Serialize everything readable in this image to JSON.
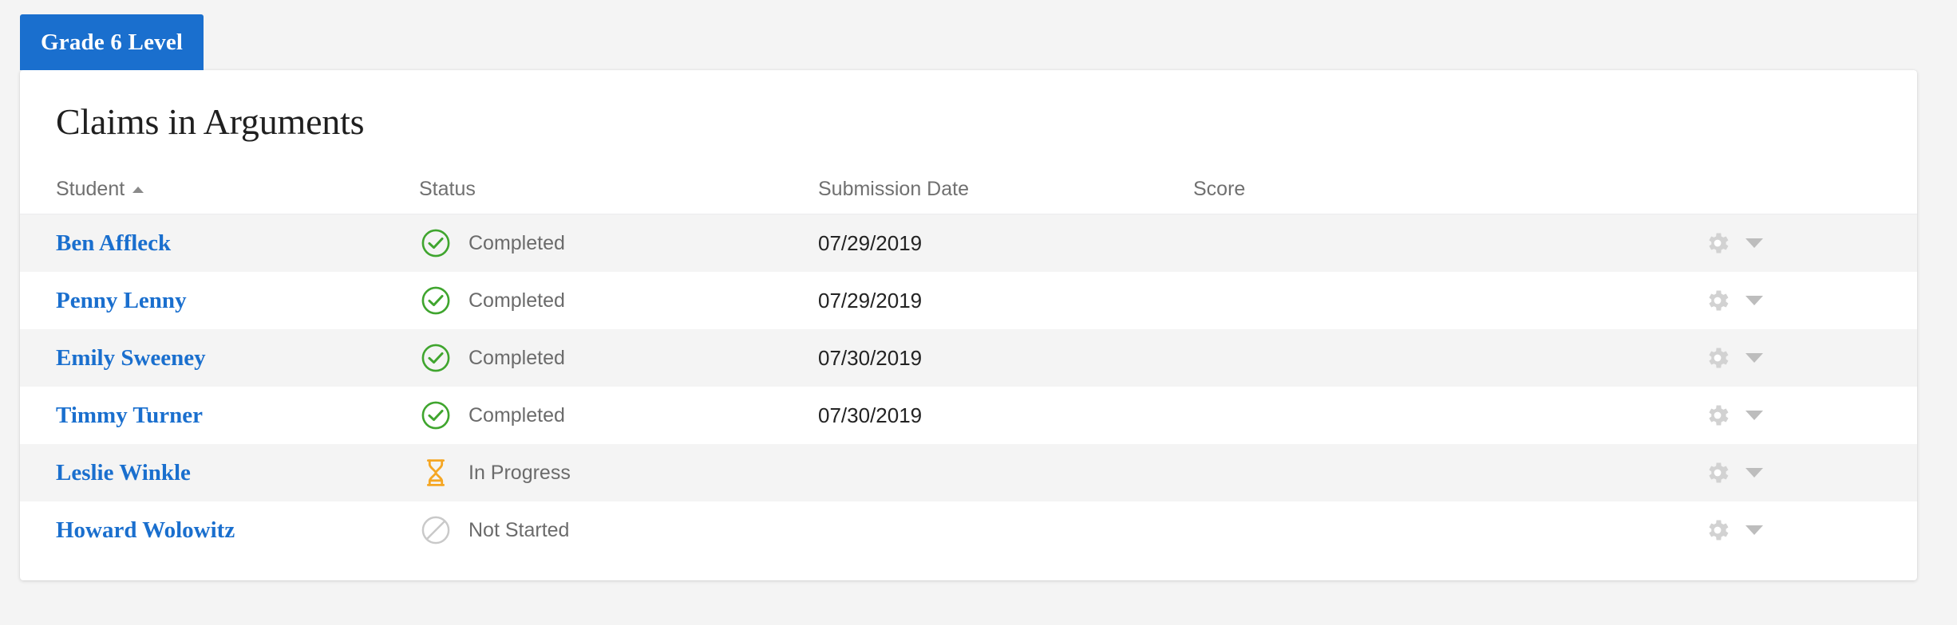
{
  "tabs": [
    {
      "label": "Grade 6 Level",
      "active": true
    }
  ],
  "card": {
    "title": "Claims in Arguments"
  },
  "table": {
    "columns": [
      {
        "key": "student",
        "label": "Student",
        "sorted": "asc",
        "sort_icon": "caret-up-icon"
      },
      {
        "key": "status",
        "label": "Status"
      },
      {
        "key": "date",
        "label": "Submission Date"
      },
      {
        "key": "score",
        "label": "Score"
      }
    ],
    "rows": [
      {
        "student": "Ben Affleck",
        "status": "Completed",
        "status_icon": "check-circle-icon",
        "date": "07/29/2019",
        "score": "",
        "actions_icon": "gear-icon",
        "menu_icon": "caret-down-icon"
      },
      {
        "student": "Penny Lenny",
        "status": "Completed",
        "status_icon": "check-circle-icon",
        "date": "07/29/2019",
        "score": "",
        "actions_icon": "gear-icon",
        "menu_icon": "caret-down-icon"
      },
      {
        "student": "Emily Sweeney",
        "status": "Completed",
        "status_icon": "check-circle-icon",
        "date": "07/30/2019",
        "score": "",
        "actions_icon": "gear-icon",
        "menu_icon": "caret-down-icon"
      },
      {
        "student": "Timmy Turner",
        "status": "Completed",
        "status_icon": "check-circle-icon",
        "date": "07/30/2019",
        "score": "",
        "actions_icon": "gear-icon",
        "menu_icon": "caret-down-icon"
      },
      {
        "student": "Leslie Winkle",
        "status": "In Progress",
        "status_icon": "hourglass-icon",
        "date": "",
        "score": "",
        "actions_icon": "gear-icon",
        "menu_icon": "caret-down-icon"
      },
      {
        "student": "Howard Wolowitz",
        "status": "Not Started",
        "status_icon": "prohibited-circle-icon",
        "date": "",
        "score": "",
        "actions_icon": "gear-icon",
        "menu_icon": "caret-down-icon"
      }
    ]
  },
  "colors": {
    "tab_active": "#1a6fce",
    "link": "#1a6fce",
    "status_completed": "#3fa52e",
    "status_in_progress": "#f5a623",
    "status_not_started": "#c9c9c9",
    "row_alt": "#f4f4f4",
    "page_background": "#f4f4f4"
  }
}
